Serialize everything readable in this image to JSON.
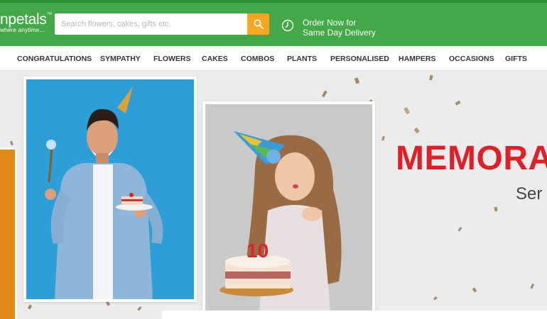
{
  "brand": {
    "logo_name": "npetals",
    "logo_tm": "™",
    "logo_tagline": "where anytime...",
    "colors": {
      "header_green": "#44a848",
      "search_orange": "#f5a623",
      "headline_red": "#dd2128"
    }
  },
  "search": {
    "placeholder": "Search flowers, cakes, gifts etc.",
    "value": "",
    "button_icon": "search-icon"
  },
  "delivery_promo": {
    "icon": "clock-icon",
    "line1": "Order Now for",
    "line2": "Same Day Delivery"
  },
  "nav": {
    "items": [
      {
        "label": "CONGRATULATIONS"
      },
      {
        "label": "SYMPATHY"
      },
      {
        "label": "FLOWERS"
      },
      {
        "label": "CAKES"
      },
      {
        "label": "COMBOS"
      },
      {
        "label": "PLANTS"
      },
      {
        "label": "PERSONALISED"
      },
      {
        "label": "HAMPERS"
      },
      {
        "label": "OCCASIONS"
      },
      {
        "label": "GIFTS"
      }
    ]
  },
  "banner": {
    "headline": "MEMORA",
    "subline": "Ser",
    "cake_number": "10"
  }
}
